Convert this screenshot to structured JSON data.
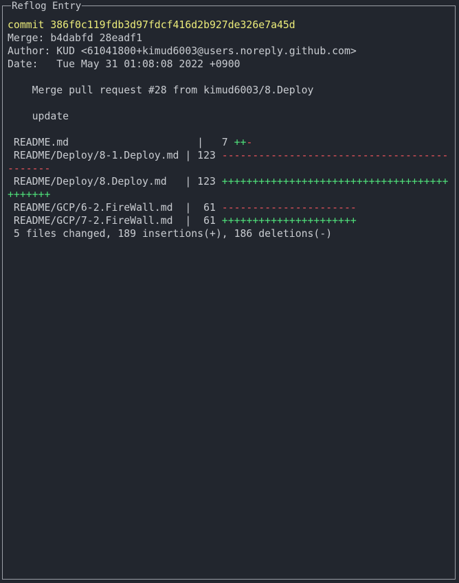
{
  "panel": {
    "title": "Reflog Entry"
  },
  "commit": {
    "line": "commit 386f0c119fdb3d97fdcf416d2b927de326e7a45d",
    "merge": "Merge: b4dabfd 28eadf1",
    "author": "Author: KUD <61041800+kimud6003@users.noreply.github.com>",
    "date": "Date:   Tue May 31 01:08:08 2022 +0900"
  },
  "message": {
    "subject": "    Merge pull request #28 from kimud6003/8.Deploy",
    "body": "    update"
  },
  "diffstat": {
    "files": [
      {
        "label": " README.md                     |   7 ",
        "plus": "++",
        "minus": "-",
        "wrap_plus": "",
        "wrap_minus": ""
      },
      {
        "label": " README/Deploy/8-1.Deploy.md | 123 ",
        "plus": "",
        "minus": "-------------------------------------",
        "wrap_plus": "",
        "wrap_minus": "-------"
      },
      {
        "label": " README/Deploy/8.Deploy.md   | 123 ",
        "plus": "+++++++++++++++++++++++++++++++++++++",
        "minus": "",
        "wrap_plus": "+++++++",
        "wrap_minus": ""
      },
      {
        "label": " README/GCP/6-2.FireWall.md  |  61 ",
        "plus": "",
        "minus": "----------------------",
        "wrap_plus": "",
        "wrap_minus": ""
      },
      {
        "label": " README/GCP/7-2.FireWall.md  |  61 ",
        "plus": "++++++++++++++++++++++",
        "minus": "",
        "wrap_plus": "",
        "wrap_minus": ""
      }
    ],
    "summary": " 5 files changed, 189 insertions(+), 186 deletions(-)"
  },
  "colors": {
    "background": "#22262e",
    "text": "#c9ccd1",
    "commit_hash": "#ecec7a",
    "insertions": "#4fe07a",
    "deletions": "#f0565d",
    "border": "#9da1a8"
  }
}
